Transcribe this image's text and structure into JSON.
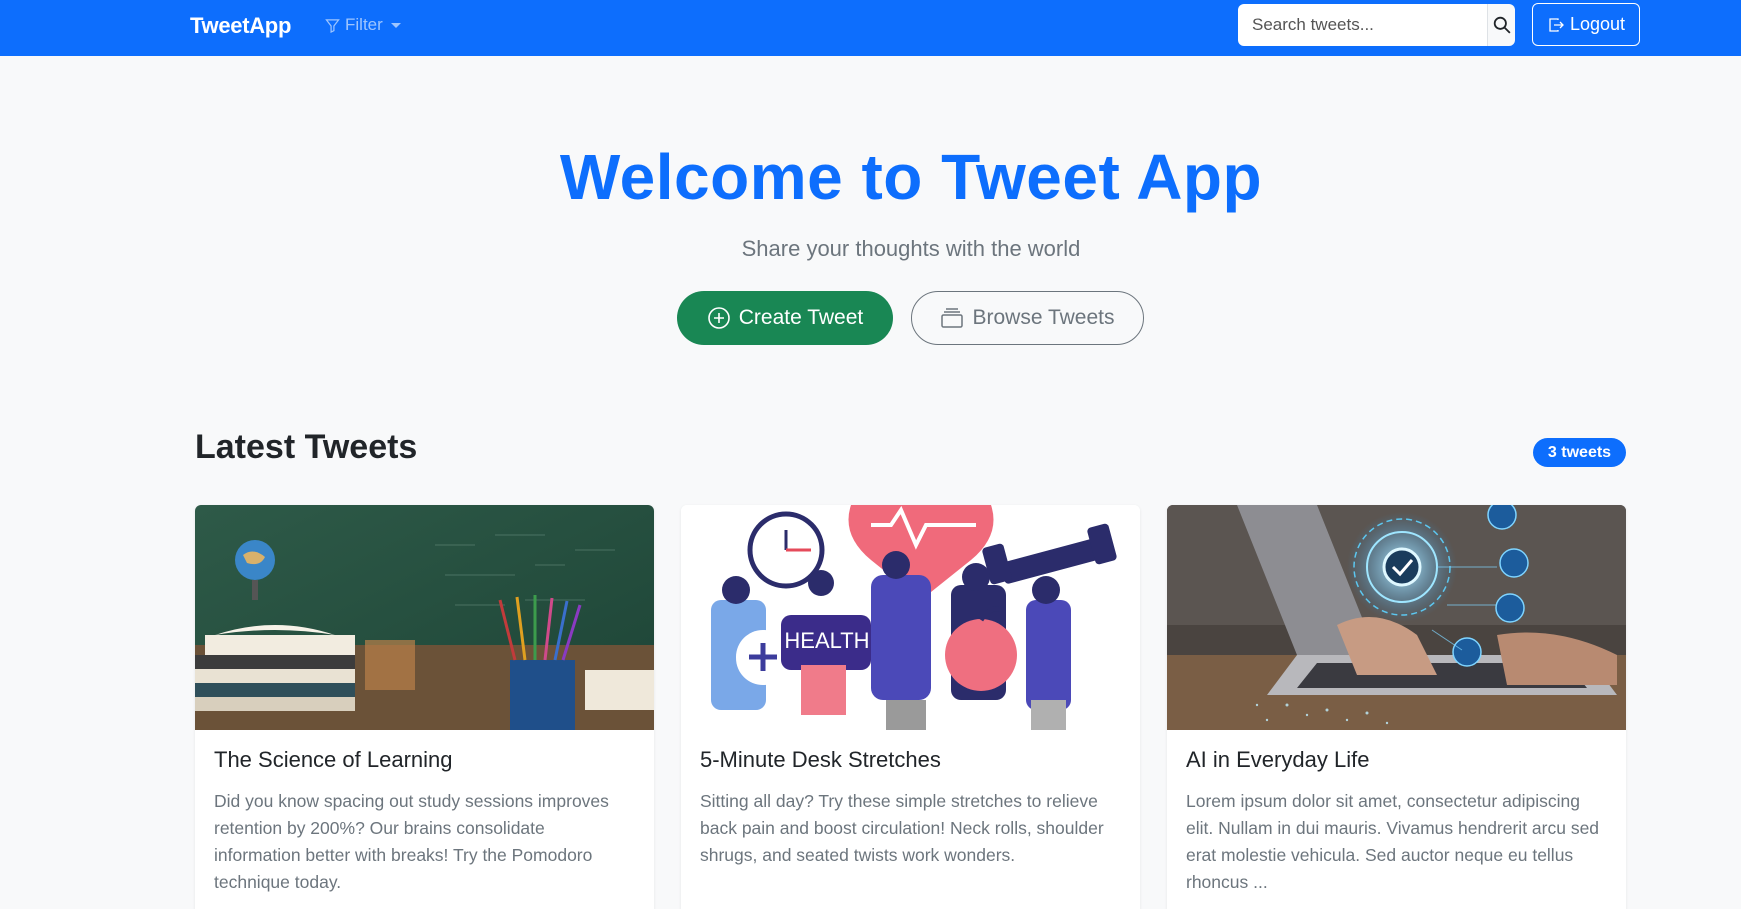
{
  "navbar": {
    "brand": "TweetApp",
    "filter_label": "Filter",
    "search_placeholder": "Search tweets...",
    "logout_label": "Logout",
    "color": "#0d6efd"
  },
  "hero": {
    "title": "Welcome to Tweet App",
    "subtitle": "Share your thoughts with the world",
    "create_label": "Create Tweet",
    "browse_label": "Browse Tweets"
  },
  "latest": {
    "title": "Latest Tweets",
    "count_badge": "3 tweets"
  },
  "tweets": [
    {
      "title": "The Science of Learning",
      "text": "Did you know spacing out study sessions improves retention by 200%? Our brains consolidate information better with breaks! Try the Pomodoro technique today.",
      "image": "books-and-pencils-classroom"
    },
    {
      "title": "5-Minute Desk Stretches",
      "text": "Sitting all day? Try these simple stretches to relieve back pain and boost circulation! Neck rolls, shoulder shrugs, and seated twists work wonders.",
      "image": "health-illustration",
      "image_text": "HEALTH"
    },
    {
      "title": "AI in Everyday Life",
      "text": "Lorem ipsum dolor sit amet, consectetur adipiscing elit. Nullam in dui mauris. Vivamus hendrerit arcu sed erat molestie vehicula. Sed auctor neque eu tellus rhoncus ...",
      "image": "laptop-ai-icons"
    }
  ],
  "colors": {
    "primary": "#0d6efd",
    "success": "#198754",
    "secondary": "#6c757d"
  }
}
